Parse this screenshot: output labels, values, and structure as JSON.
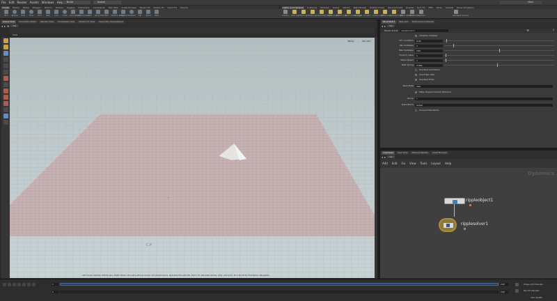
{
  "menubar": {
    "items": [
      "File",
      "Edit",
      "Render",
      "Assets",
      "Windows",
      "Help"
    ],
    "build_desk": "Build",
    "scene": "Scene",
    "window_title": "Main"
  },
  "shelf_tabs": [
    "Create",
    "Modify",
    "Model",
    "Polygon",
    "Deform",
    "Texture",
    "Rigging",
    "Characters",
    "Constraints",
    "Hair Utils",
    "Guide Process",
    "Terrain FX",
    "Simple FX",
    "Cloud FX",
    "Volume"
  ],
  "shelf_tools": [
    "Box",
    "Sphere",
    "Tube",
    "Torus",
    "Grid",
    "Null",
    "Line",
    "Circle",
    "Curve Bezier",
    "Draw Curve",
    "Path",
    "Spray Paint",
    "Text",
    "Platonic Solids",
    "L-System",
    "Metaball",
    "File",
    "Spiral",
    "Helix"
  ],
  "light_tabs": [
    "Lights and Cameras",
    "Collisions",
    "Particles",
    "Grains",
    "Vellum",
    "Rigid Bodies",
    "Particle Fluids",
    "Viscous Fluids",
    "Oceans",
    "Pyro FX",
    "FEM",
    "Wires",
    "Crowds",
    "Drive Simulation"
  ],
  "light_tools": [
    "Camera",
    "Point Light",
    "Spot Light",
    "Area Light",
    "Geometry Light",
    "Volume Light",
    "Distant Light",
    "Environment Light",
    "Sky Light",
    "GI Light",
    "Caustic Light",
    "Portal Light",
    "Ambient Light",
    "Stereo Camera",
    "VR Camera",
    "Switcher",
    "Gamepad Camera"
  ],
  "left_panes": [
    "Scene View",
    "Animation Editor",
    "Render View",
    "Composite View",
    "Motion FX View",
    "Geometry Spreadsheet"
  ],
  "right_panes": [
    "Parameters",
    "Take List",
    "Performance Monitor"
  ],
  "viewport": {
    "header": "View",
    "path": "obj",
    "persp": "Persp",
    "cam": "No cam",
    "status": "Left mouse tumbles. Middle pans. Right dollies. Ctrl+Alt+Left box zooms. Ctrl+Right zooms. Spacebar-Ctrl-Left tilts. Hold L for alternate tumble, dolly, and zoom.    M or Alt+M for First Person Navigation."
  },
  "parameters": {
    "node_type": "Ripple Solver",
    "node_name": "ripplesolver1",
    "path": "obj",
    "adaptive_label": "Adaptive Substep",
    "rows": [
      {
        "label": "CFL Condition",
        "value": "0.02",
        "fraction": 0.02
      },
      {
        "label": "Min Substeps",
        "value": "1",
        "fraction": 0.08
      },
      {
        "label": "Max Substeps",
        "value": "100",
        "fraction": 0.5
      },
      {
        "label": "Custom value",
        "value": "1",
        "fraction": 0.01
      },
      {
        "label": "Wave Speed",
        "value": "1",
        "fraction": 0.01
      },
      {
        "label": "Rest Spring",
        "value": "0.002",
        "fraction": 0.48
      }
    ],
    "checks": [
      {
        "label": "Use Rest as Position",
        "on": false
      },
      {
        "label": "Use Edge Lists",
        "on": true
      },
      {
        "label": "Use Rest Edits",
        "on": true
      }
    ],
    "rest_state_label": "Rest State",
    "rest_state_value": "rest",
    "make_objects_label": "Make Objects Mutual Affectors",
    "group_label": "Group",
    "group_value": "*",
    "data_name_label": "Data Name",
    "data_name_value": "Solver",
    "unique_label": "Unique Data Name"
  },
  "network": {
    "tabs": [
      "/obj/ripple",
      "Tree View",
      "Material Palette",
      "Asset Browser"
    ],
    "path": "obj",
    "menu": [
      "Add",
      "Edit",
      "Go",
      "View",
      "Tools",
      "Layout",
      "Help"
    ],
    "context": "Dynamics",
    "nodes": [
      "rippleobject1",
      "ripplesolver1"
    ]
  },
  "timeline": {
    "frame": "1",
    "start": "1",
    "end": "240",
    "end2": "240",
    "keys_label": "0 keys, 0/0 channels",
    "key_all_label": "Key All Channels",
    "auto_update": "Auto Update"
  }
}
